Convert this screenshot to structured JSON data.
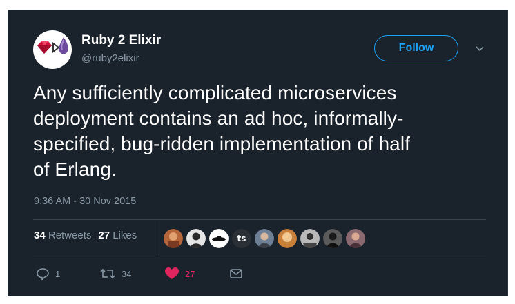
{
  "author": {
    "display_name": "Ruby 2 Elixir",
    "handle": "@ruby2elixir"
  },
  "follow_label": "Follow",
  "tweet": {
    "lines": [
      "Any sufficiently complicated microservices",
      "deployment contains an ad hoc, informally-",
      "specified, bug-ridden implementation of half",
      "of Erlang."
    ],
    "timestamp": "9:36 AM - 30 Nov 2015"
  },
  "stats": {
    "retweets_count": "34",
    "retweets_label": "Retweets",
    "likes_count": "27",
    "likes_label": "Likes"
  },
  "likers": [
    {
      "icon": "photo-avatar",
      "color": "#b5653a"
    },
    {
      "icon": "photo-avatar",
      "color": "#e6e6e6"
    },
    {
      "icon": "logo-avatar",
      "color": "#ffffff"
    },
    {
      "icon": "text-avatar",
      "text": "ts",
      "color": "#2b2f36"
    },
    {
      "icon": "photo-avatar",
      "color": "#6e8096"
    },
    {
      "icon": "photo-avatar",
      "color": "#c9803a"
    },
    {
      "icon": "photo-avatar",
      "color": "#b8b8b8"
    },
    {
      "icon": "photo-avatar",
      "color": "#5a5a5a"
    },
    {
      "icon": "photo-avatar",
      "color": "#8a6a70"
    }
  ],
  "actions": {
    "reply_count": "1",
    "retweet_count": "34",
    "like_count": "27"
  },
  "colors": {
    "background": "#1a222c",
    "accent": "#1da1f2",
    "like": "#e0245e",
    "muted": "#8899a6"
  }
}
